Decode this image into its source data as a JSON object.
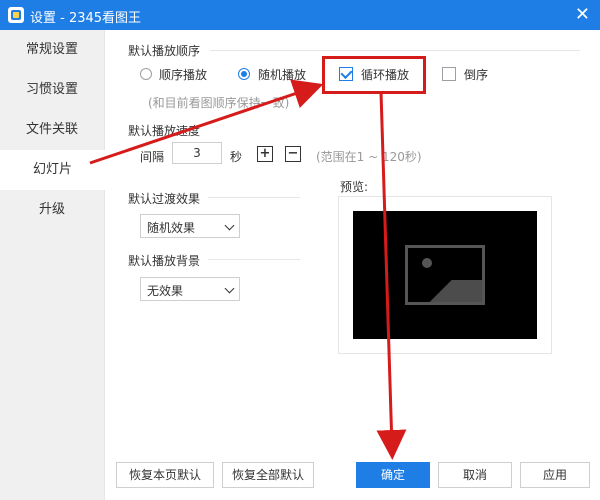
{
  "window": {
    "title": "设置 - 2345看图王",
    "close_glyph": "✕"
  },
  "sidebar": {
    "items": [
      {
        "label": "常规设置"
      },
      {
        "label": "习惯设置"
      },
      {
        "label": "文件关联"
      },
      {
        "label": "幻灯片"
      },
      {
        "label": "升级"
      }
    ]
  },
  "main": {
    "order": {
      "title": "默认播放顺序",
      "sequential": "顺序播放",
      "random": "随机播放",
      "loop": "循环播放",
      "reverse": "倒序",
      "note": "(和目前看图顺序保持一致)"
    },
    "speed": {
      "title": "默认播放速度",
      "interval_label": "间隔",
      "value": "3",
      "unit": "秒",
      "plus": "+",
      "minus": "−",
      "range_note": "(范围在1 ~ 120秒)"
    },
    "transition": {
      "title": "默认过渡效果",
      "selected": "随机效果"
    },
    "background": {
      "title": "默认播放背景",
      "selected": "无效果"
    },
    "preview": {
      "label": "预览:"
    }
  },
  "footer": {
    "restore_page": "恢复本页默认",
    "restore_all": "恢复全部默认",
    "ok": "确定",
    "cancel": "取消",
    "apply": "应用"
  },
  "colors": {
    "accent": "#1e7ee6",
    "annotation": "#d61b1b"
  }
}
